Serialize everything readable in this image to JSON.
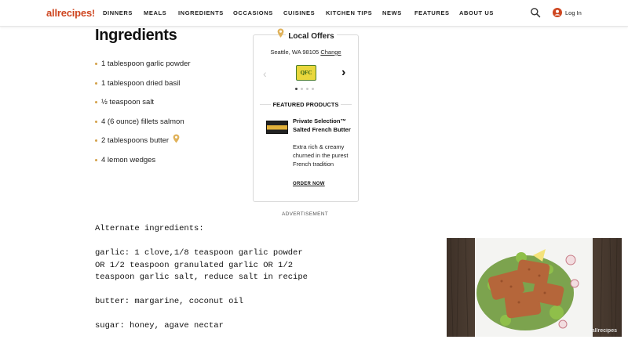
{
  "header": {
    "logo": "allrecipes",
    "nav": [
      "DINNERS",
      "MEALS",
      "INGREDIENTS",
      "OCCASIONS",
      "CUISINES",
      "KITCHEN TIPS",
      "NEWS",
      "FEATURES",
      "ABOUT US"
    ],
    "login_label": "Log In"
  },
  "ingredients": {
    "title": "Ingredients",
    "items": [
      "1 tablespoon garlic powder",
      "1 tablespoon dried basil",
      "½ teaspoon salt",
      "4 (6 ounce) fillets salmon",
      "2 tablespoons butter",
      "4 lemon wedges"
    ]
  },
  "local_offers": {
    "title": "Local Offers",
    "location": "Seattle, WA 98105",
    "change_label": "Change",
    "store_logo": "QFC",
    "featured_heading": "FEATURED PRODUCTS",
    "product_name": "Private Selection™ Salted French Butter",
    "product_desc": "Extra rich & creamy churned in the purest French tradition",
    "order_label": "ORDER NOW",
    "carousel_active_index": 0
  },
  "ad_label": "ADVERTISEMENT",
  "alternate": {
    "heading": "Alternate ingredients:",
    "garlic": [
      "garlic: 1 clove,1/8 teaspoon garlic powder",
      "OR 1/2 teaspoon granulated garlic OR 1/2",
      "teaspoon garlic salt, reduce salt in recipe"
    ],
    "butter": "butter: margarine, coconut oil",
    "sugar": "sugar: honey, agave nectar"
  },
  "video": {
    "watermark": "allrecipes"
  },
  "colors": {
    "brand": "#ce4620",
    "accent_gold": "#d3a14a"
  }
}
